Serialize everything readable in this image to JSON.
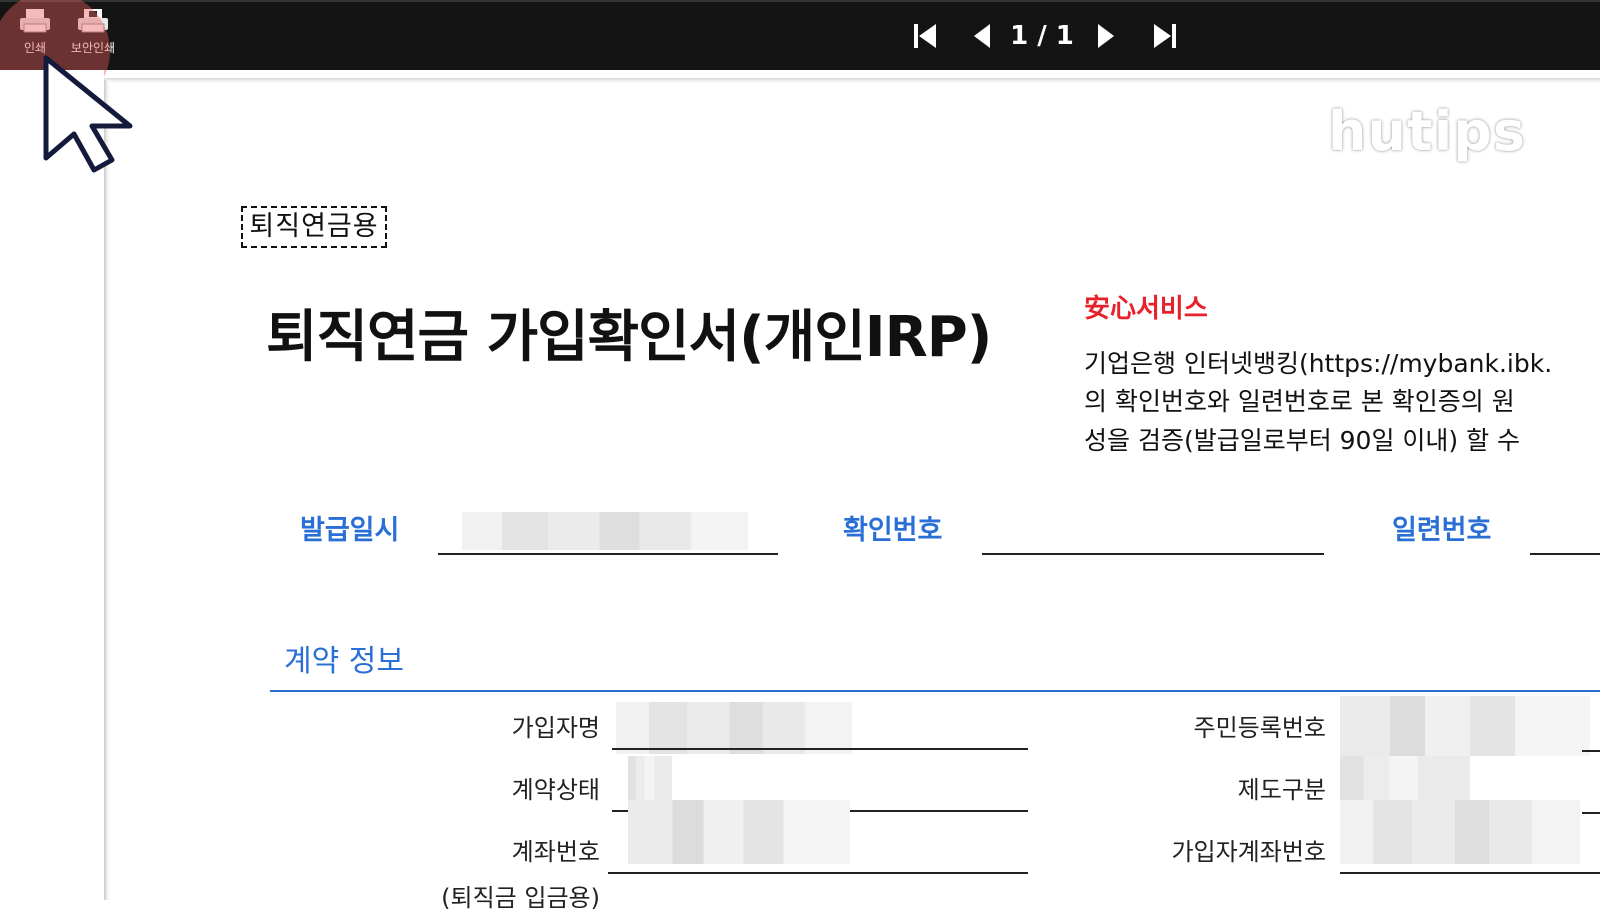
{
  "toolbar": {
    "print_label": "인쇄",
    "secure_print_label": "보안인쇄",
    "page_indicator": "1 / 1"
  },
  "watermark": "hutips",
  "document": {
    "tag": "퇴직연금용",
    "title": "퇴직연금 가입확인서(개인IRP)",
    "service": {
      "title": "安心서비스",
      "lines": [
        "기업은행 인터넷뱅킹(https://mybank.ibk.",
        "의 확인번호와 일련번호로 본 확인증의 원",
        "성을 검증(발급일로부터 90일 이내) 할 수"
      ]
    },
    "fields": {
      "issue_date_label": "발급일시",
      "confirm_no_label": "확인번호",
      "serial_no_label": "일련번호"
    },
    "section_title": "계약 정보",
    "rows_left": [
      "가입자명",
      "계약상태",
      "계좌번호"
    ],
    "rows_right": [
      "주민등록번호",
      "제도구분",
      "가입자계좌번호"
    ],
    "cut_label": "(퇴직금 입금용)"
  },
  "colors": {
    "accent_blue": "#2a6fd6",
    "service_red": "#e8222b",
    "toolbar_bg": "#141414"
  }
}
